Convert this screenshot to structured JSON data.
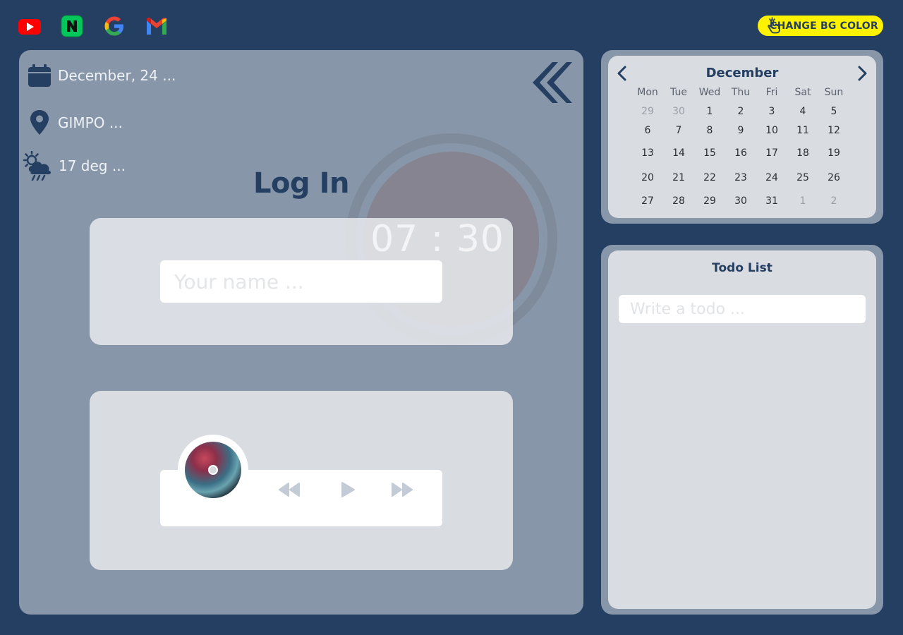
{
  "shortcuts": [
    {
      "name": "youtube-icon",
      "color": "#ff0000"
    },
    {
      "name": "naver-icon",
      "color": "#03c75a"
    },
    {
      "name": "google-icon",
      "color": "#4285f4"
    },
    {
      "name": "gmail-icon",
      "color": "#ea4335"
    }
  ],
  "bg_button": {
    "label": "CHANGE BG COLOR",
    "icon": "hand-pointer-icon"
  },
  "info": {
    "date": "December, 24 ...",
    "location": "GIMPO ...",
    "weather": "17 deg ..."
  },
  "login": {
    "title": "Log In",
    "clock": "07 : 30",
    "name_placeholder": "Your name ..."
  },
  "player": {
    "controls": [
      "rewind-icon",
      "play-icon",
      "fast-forward-icon"
    ]
  },
  "calendar": {
    "month": "December",
    "weekdays": [
      "Mon",
      "Tue",
      "Wed",
      "Thu",
      "Fri",
      "Sat",
      "Sun"
    ],
    "weeks": [
      [
        "29",
        "30",
        "1",
        "2",
        "3",
        "4",
        "5"
      ],
      [
        "6",
        "7",
        "8",
        "9",
        "10",
        "11",
        "12"
      ],
      [
        "13",
        "14",
        "15",
        "16",
        "17",
        "18",
        "19"
      ],
      [
        "20",
        "21",
        "22",
        "23",
        "24",
        "25",
        "26"
      ],
      [
        "27",
        "28",
        "29",
        "30",
        "31",
        "1",
        "2"
      ]
    ],
    "muted": [
      [
        0,
        0
      ],
      [
        0,
        1
      ],
      [
        4,
        5
      ],
      [
        4,
        6
      ]
    ]
  },
  "todo": {
    "title": "Todo List",
    "placeholder": "Write a todo ..."
  },
  "colors": {
    "background": "#243f61",
    "panel": "#8796a8",
    "card": "#d9dce0",
    "accent_button": "#fff200",
    "text_dark": "#243f61"
  }
}
